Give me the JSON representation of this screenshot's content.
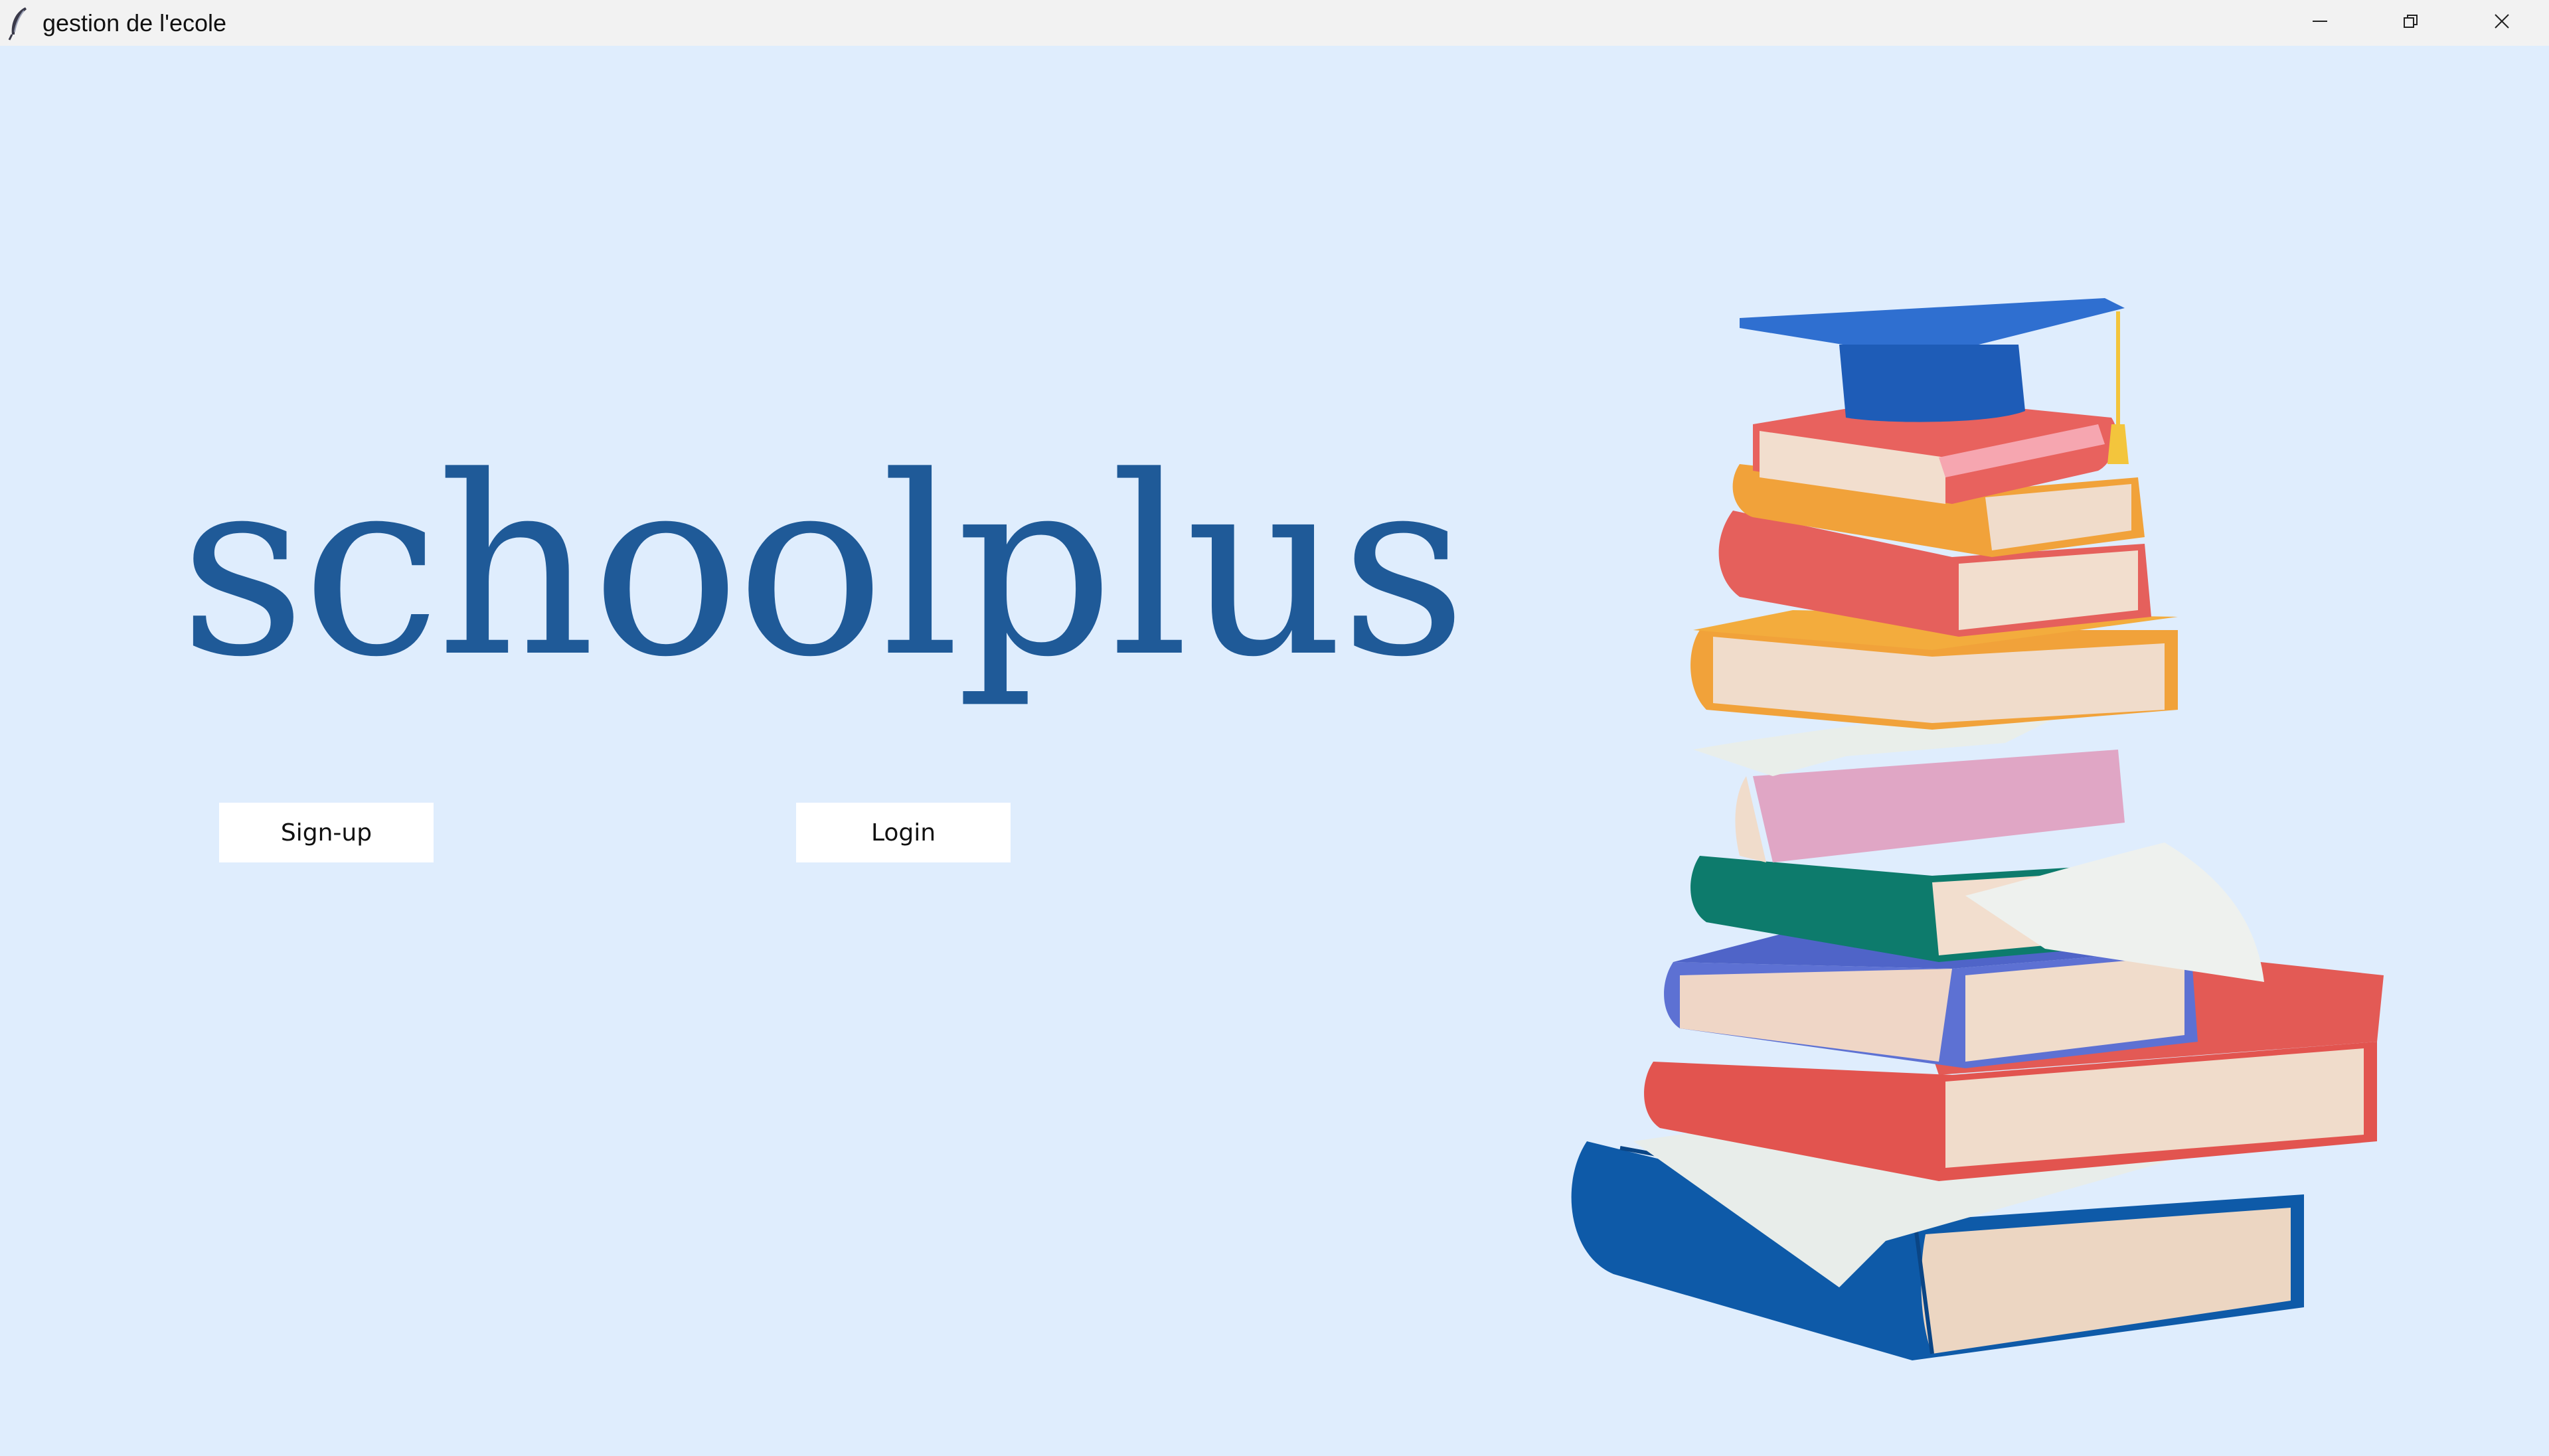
{
  "window": {
    "title": "gestion de l'ecole",
    "app_icon": "feather-icon",
    "controls": [
      "minimize-icon",
      "restore-icon",
      "close-icon"
    ]
  },
  "main": {
    "brand": "schoolplus",
    "signup_label": "Sign-up",
    "login_label": "Login",
    "illustration": "books-stack-graduation-cap-image"
  },
  "colors": {
    "background": "#dfedfd",
    "brand_text": "#1f5a98",
    "button_bg": "#ffffff",
    "titlebar": "#f2f2f2"
  }
}
